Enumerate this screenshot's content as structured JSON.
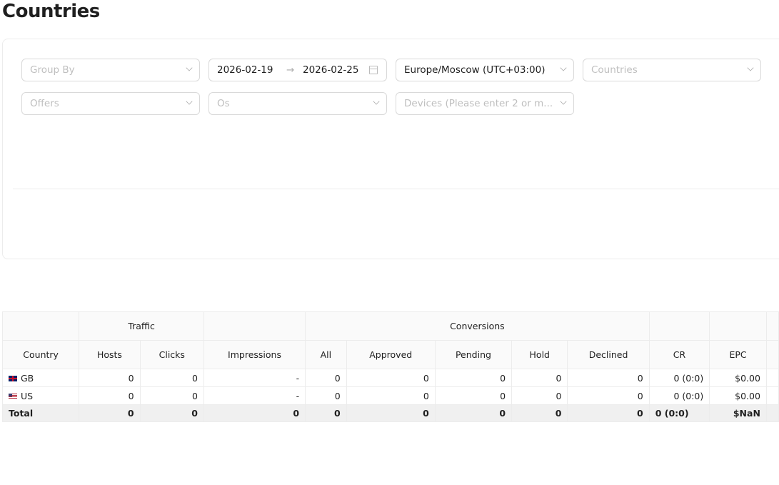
{
  "page": {
    "title": "Countries"
  },
  "filters": {
    "group_by": {
      "placeholder": "Group By"
    },
    "date_range": {
      "start": "2026-02-19",
      "end": "2026-02-25",
      "separator": "→"
    },
    "timezone": {
      "value": "Europe/Moscow (UTC+03:00)"
    },
    "countries": {
      "placeholder": "Countries"
    },
    "offers": {
      "placeholder": "Offers"
    },
    "os": {
      "placeholder": "Os"
    },
    "devices": {
      "placeholder": "Devices (Please enter 2 or m..."
    }
  },
  "table": {
    "groups": {
      "traffic": "Traffic",
      "conversions": "Conversions"
    },
    "columns": [
      "Country",
      "Hosts",
      "Clicks",
      "Impressions",
      "All",
      "Approved",
      "Pending",
      "Hold",
      "Declined",
      "CR",
      "EPC"
    ],
    "rows": [
      {
        "flag": "gb",
        "cells": [
          "GB",
          "0",
          "0",
          "-",
          "0",
          "0",
          "0",
          "0",
          "0",
          "0 (0:0)",
          "$0.00"
        ]
      },
      {
        "flag": "us",
        "cells": [
          "US",
          "0",
          "0",
          "-",
          "0",
          "0",
          "0",
          "0",
          "0",
          "0 (0:0)",
          "$0.00"
        ]
      }
    ],
    "total": [
      "Total",
      "0",
      "0",
      "0",
      "0",
      "0",
      "0",
      "0",
      "0",
      "0 (0:0)",
      "$NaN"
    ]
  }
}
